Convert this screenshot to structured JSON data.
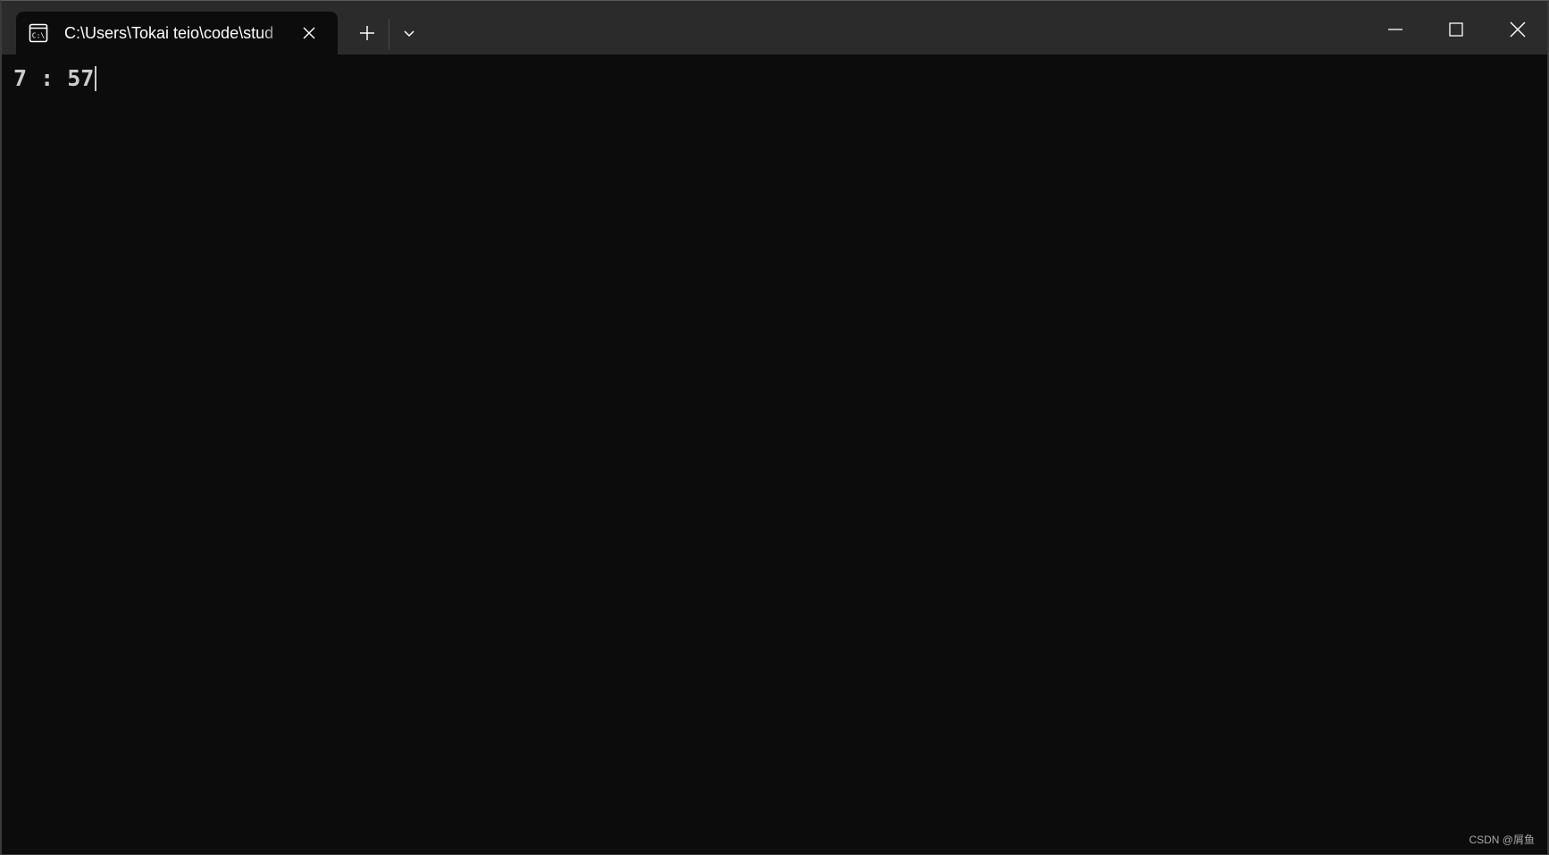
{
  "window": {
    "tab_title": "C:\\Users\\Tokai teio\\code\\stud",
    "icons": {
      "tab": "console-icon",
      "close_tab": "close-icon",
      "new_tab": "plus-icon",
      "dropdown": "chevron-down-icon",
      "minimize": "minimize-icon",
      "maximize": "maximize-icon",
      "close_window": "close-icon"
    }
  },
  "terminal": {
    "output_line": "7 : 57"
  },
  "watermark": "CSDN @屑鱼",
  "colors": {
    "titlebar": "#2b2b2b",
    "terminal_bg": "#0c0c0c",
    "text": "#cccccc"
  }
}
